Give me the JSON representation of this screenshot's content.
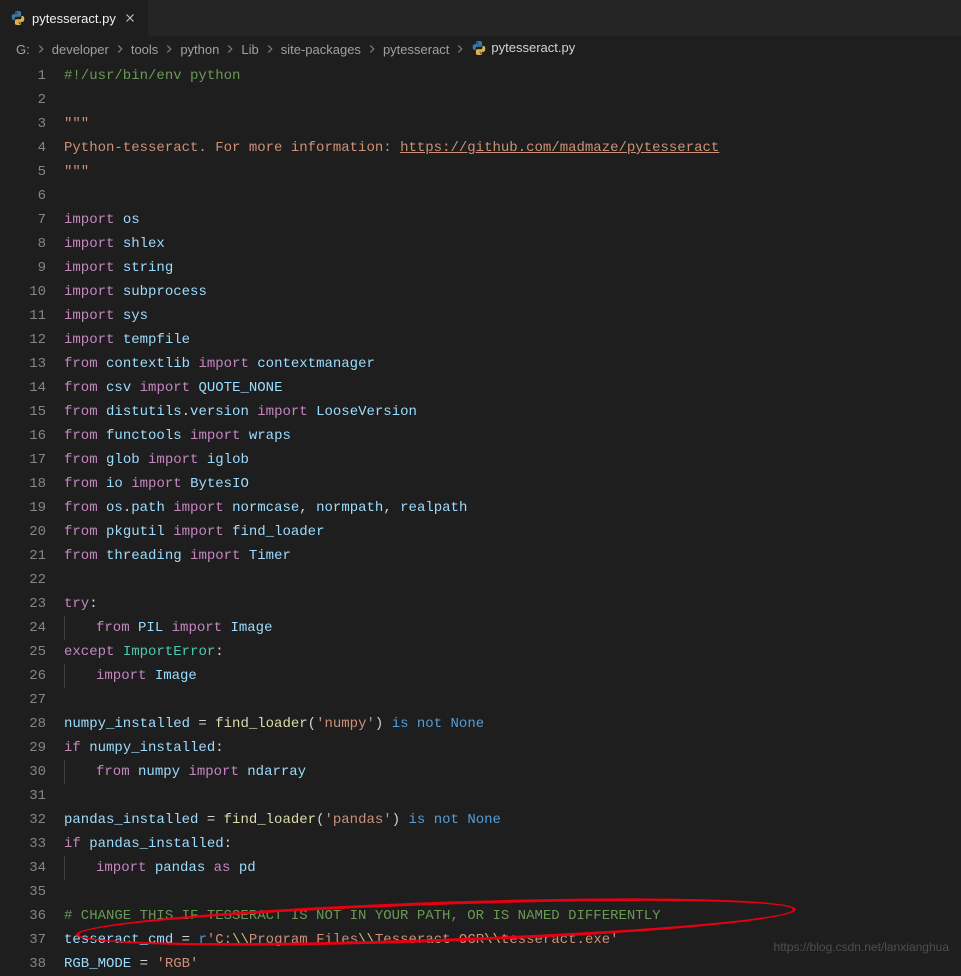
{
  "tab": {
    "filename": "pytesseract.py"
  },
  "breadcrumbs": [
    "G:",
    "developer",
    "tools",
    "python",
    "Lib",
    "site-packages",
    "pytesseract",
    "pytesseract.py"
  ],
  "watermark": "https://blog.csdn.net/lanxianghua",
  "code": {
    "lines": [
      {
        "n": 1,
        "t": [
          [
            "hl-comment",
            "#!/usr/bin/env python"
          ]
        ]
      },
      {
        "n": 2,
        "t": []
      },
      {
        "n": 3,
        "t": [
          [
            "hl-string",
            "\"\"\""
          ]
        ]
      },
      {
        "n": 4,
        "t": [
          [
            "hl-string",
            "Python-tesseract. For more information: "
          ],
          [
            "hl-link",
            "https://github.com/madmaze/pytesseract"
          ]
        ]
      },
      {
        "n": 5,
        "t": [
          [
            "hl-string",
            "\"\"\""
          ]
        ]
      },
      {
        "n": 6,
        "t": []
      },
      {
        "n": 7,
        "t": [
          [
            "hl-keyword",
            "import"
          ],
          [
            "hl-default",
            " "
          ],
          [
            "hl-identifier",
            "os"
          ]
        ]
      },
      {
        "n": 8,
        "t": [
          [
            "hl-keyword",
            "import"
          ],
          [
            "hl-default",
            " "
          ],
          [
            "hl-identifier",
            "shlex"
          ]
        ]
      },
      {
        "n": 9,
        "t": [
          [
            "hl-keyword",
            "import"
          ],
          [
            "hl-default",
            " "
          ],
          [
            "hl-identifier",
            "string"
          ]
        ]
      },
      {
        "n": 10,
        "t": [
          [
            "hl-keyword",
            "import"
          ],
          [
            "hl-default",
            " "
          ],
          [
            "hl-identifier",
            "subprocess"
          ]
        ]
      },
      {
        "n": 11,
        "t": [
          [
            "hl-keyword",
            "import"
          ],
          [
            "hl-default",
            " "
          ],
          [
            "hl-identifier",
            "sys"
          ]
        ]
      },
      {
        "n": 12,
        "t": [
          [
            "hl-keyword",
            "import"
          ],
          [
            "hl-default",
            " "
          ],
          [
            "hl-identifier",
            "tempfile"
          ]
        ]
      },
      {
        "n": 13,
        "t": [
          [
            "hl-keyword",
            "from"
          ],
          [
            "hl-default",
            " "
          ],
          [
            "hl-identifier",
            "contextlib"
          ],
          [
            "hl-default",
            " "
          ],
          [
            "hl-keyword",
            "import"
          ],
          [
            "hl-default",
            " "
          ],
          [
            "hl-identifier",
            "contextmanager"
          ]
        ]
      },
      {
        "n": 14,
        "t": [
          [
            "hl-keyword",
            "from"
          ],
          [
            "hl-default",
            " "
          ],
          [
            "hl-identifier",
            "csv"
          ],
          [
            "hl-default",
            " "
          ],
          [
            "hl-keyword",
            "import"
          ],
          [
            "hl-default",
            " "
          ],
          [
            "hl-identifier",
            "QUOTE_NONE"
          ]
        ]
      },
      {
        "n": 15,
        "t": [
          [
            "hl-keyword",
            "from"
          ],
          [
            "hl-default",
            " "
          ],
          [
            "hl-identifier",
            "distutils"
          ],
          [
            "hl-default",
            "."
          ],
          [
            "hl-identifier",
            "version"
          ],
          [
            "hl-default",
            " "
          ],
          [
            "hl-keyword",
            "import"
          ],
          [
            "hl-default",
            " "
          ],
          [
            "hl-identifier",
            "LooseVersion"
          ]
        ]
      },
      {
        "n": 16,
        "t": [
          [
            "hl-keyword",
            "from"
          ],
          [
            "hl-default",
            " "
          ],
          [
            "hl-identifier",
            "functools"
          ],
          [
            "hl-default",
            " "
          ],
          [
            "hl-keyword",
            "import"
          ],
          [
            "hl-default",
            " "
          ],
          [
            "hl-identifier",
            "wraps"
          ]
        ]
      },
      {
        "n": 17,
        "t": [
          [
            "hl-keyword",
            "from"
          ],
          [
            "hl-default",
            " "
          ],
          [
            "hl-identifier",
            "glob"
          ],
          [
            "hl-default",
            " "
          ],
          [
            "hl-keyword",
            "import"
          ],
          [
            "hl-default",
            " "
          ],
          [
            "hl-identifier",
            "iglob"
          ]
        ]
      },
      {
        "n": 18,
        "t": [
          [
            "hl-keyword",
            "from"
          ],
          [
            "hl-default",
            " "
          ],
          [
            "hl-identifier",
            "io"
          ],
          [
            "hl-default",
            " "
          ],
          [
            "hl-keyword",
            "import"
          ],
          [
            "hl-default",
            " "
          ],
          [
            "hl-identifier",
            "BytesIO"
          ]
        ]
      },
      {
        "n": 19,
        "t": [
          [
            "hl-keyword",
            "from"
          ],
          [
            "hl-default",
            " "
          ],
          [
            "hl-identifier",
            "os"
          ],
          [
            "hl-default",
            "."
          ],
          [
            "hl-identifier",
            "path"
          ],
          [
            "hl-default",
            " "
          ],
          [
            "hl-keyword",
            "import"
          ],
          [
            "hl-default",
            " "
          ],
          [
            "hl-identifier",
            "normcase"
          ],
          [
            "hl-default",
            ", "
          ],
          [
            "hl-identifier",
            "normpath"
          ],
          [
            "hl-default",
            ", "
          ],
          [
            "hl-identifier",
            "realpath"
          ]
        ]
      },
      {
        "n": 20,
        "t": [
          [
            "hl-keyword",
            "from"
          ],
          [
            "hl-default",
            " "
          ],
          [
            "hl-identifier",
            "pkgutil"
          ],
          [
            "hl-default",
            " "
          ],
          [
            "hl-keyword",
            "import"
          ],
          [
            "hl-default",
            " "
          ],
          [
            "hl-identifier",
            "find_loader"
          ]
        ]
      },
      {
        "n": 21,
        "t": [
          [
            "hl-keyword",
            "from"
          ],
          [
            "hl-default",
            " "
          ],
          [
            "hl-identifier",
            "threading"
          ],
          [
            "hl-default",
            " "
          ],
          [
            "hl-keyword",
            "import"
          ],
          [
            "hl-default",
            " "
          ],
          [
            "hl-identifier",
            "Timer"
          ]
        ]
      },
      {
        "n": 22,
        "t": []
      },
      {
        "n": 23,
        "t": [
          [
            "hl-keyword",
            "try"
          ],
          [
            "hl-default",
            ":"
          ]
        ]
      },
      {
        "n": 24,
        "indent": 1,
        "t": [
          [
            "hl-keyword",
            "from"
          ],
          [
            "hl-default",
            " "
          ],
          [
            "hl-identifier",
            "PIL"
          ],
          [
            "hl-default",
            " "
          ],
          [
            "hl-keyword",
            "import"
          ],
          [
            "hl-default",
            " "
          ],
          [
            "hl-identifier",
            "Image"
          ]
        ]
      },
      {
        "n": 25,
        "t": [
          [
            "hl-keyword",
            "except"
          ],
          [
            "hl-default",
            " "
          ],
          [
            "hl-builtin",
            "ImportError"
          ],
          [
            "hl-default",
            ":"
          ]
        ]
      },
      {
        "n": 26,
        "indent": 1,
        "t": [
          [
            "hl-keyword",
            "import"
          ],
          [
            "hl-default",
            " "
          ],
          [
            "hl-identifier",
            "Image"
          ]
        ]
      },
      {
        "n": 27,
        "t": []
      },
      {
        "n": 28,
        "t": [
          [
            "hl-identifier",
            "numpy_installed"
          ],
          [
            "hl-default",
            " = "
          ],
          [
            "hl-func",
            "find_loader"
          ],
          [
            "hl-default",
            "("
          ],
          [
            "hl-string",
            "'numpy'"
          ],
          [
            "hl-default",
            ") "
          ],
          [
            "hl-const",
            "is not"
          ],
          [
            "hl-default",
            " "
          ],
          [
            "hl-const",
            "None"
          ]
        ]
      },
      {
        "n": 29,
        "t": [
          [
            "hl-keyword",
            "if"
          ],
          [
            "hl-default",
            " "
          ],
          [
            "hl-identifier",
            "numpy_installed"
          ],
          [
            "hl-default",
            ":"
          ]
        ]
      },
      {
        "n": 30,
        "indent": 1,
        "t": [
          [
            "hl-keyword",
            "from"
          ],
          [
            "hl-default",
            " "
          ],
          [
            "hl-identifier",
            "numpy"
          ],
          [
            "hl-default",
            " "
          ],
          [
            "hl-keyword",
            "import"
          ],
          [
            "hl-default",
            " "
          ],
          [
            "hl-identifier",
            "ndarray"
          ]
        ]
      },
      {
        "n": 31,
        "t": []
      },
      {
        "n": 32,
        "t": [
          [
            "hl-identifier",
            "pandas_installed"
          ],
          [
            "hl-default",
            " = "
          ],
          [
            "hl-func",
            "find_loader"
          ],
          [
            "hl-default",
            "("
          ],
          [
            "hl-string",
            "'pandas'"
          ],
          [
            "hl-default",
            ") "
          ],
          [
            "hl-const",
            "is not"
          ],
          [
            "hl-default",
            " "
          ],
          [
            "hl-const",
            "None"
          ]
        ]
      },
      {
        "n": 33,
        "t": [
          [
            "hl-keyword",
            "if"
          ],
          [
            "hl-default",
            " "
          ],
          [
            "hl-identifier",
            "pandas_installed"
          ],
          [
            "hl-default",
            ":"
          ]
        ]
      },
      {
        "n": 34,
        "indent": 1,
        "t": [
          [
            "hl-keyword",
            "import"
          ],
          [
            "hl-default",
            " "
          ],
          [
            "hl-identifier",
            "pandas"
          ],
          [
            "hl-default",
            " "
          ],
          [
            "hl-keyword",
            "as"
          ],
          [
            "hl-default",
            " "
          ],
          [
            "hl-identifier",
            "pd"
          ]
        ]
      },
      {
        "n": 35,
        "t": []
      },
      {
        "n": 36,
        "t": [
          [
            "hl-comment",
            "# CHANGE THIS IF TESSERACT IS NOT IN YOUR PATH, OR IS NAMED DIFFERENTLY"
          ]
        ]
      },
      {
        "n": 37,
        "t": [
          [
            "hl-identifier",
            "tesseract_cmd"
          ],
          [
            "hl-default",
            " = "
          ],
          [
            "hl-const",
            "r"
          ],
          [
            "hl-string",
            "'C:"
          ],
          [
            "hl-escape",
            "\\\\"
          ],
          [
            "hl-string",
            "Program Files"
          ],
          [
            "hl-escape",
            "\\\\"
          ],
          [
            "hl-string",
            "Tesseract-OCR"
          ],
          [
            "hl-escape",
            "\\\\"
          ],
          [
            "hl-string",
            "tesseract.exe'"
          ]
        ]
      },
      {
        "n": 38,
        "t": [
          [
            "hl-identifier",
            "RGB_MODE"
          ],
          [
            "hl-default",
            " = "
          ],
          [
            "hl-string",
            "'RGB'"
          ]
        ]
      }
    ]
  }
}
